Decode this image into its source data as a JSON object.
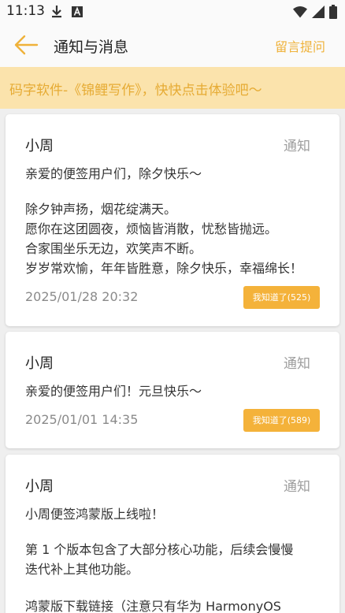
{
  "status_bar": {
    "time": "11:13",
    "icons": [
      "download-icon",
      "font-icon",
      "wifi-icon",
      "signal-icon",
      "battery-icon"
    ]
  },
  "header": {
    "title": "通知与消息",
    "feedback_label": "留言提问",
    "accent_color": "#efb23a"
  },
  "promo": {
    "text": "码字软件-《锦鲤写作》，快快点击体验吧～",
    "background": "#fbe3ac",
    "text_color": "#e6ab34"
  },
  "notifications": [
    {
      "sender": "小周",
      "type": "通知",
      "lines": [
        "亲爱的便签用户们，除夕快乐～",
        "除夕钟声扬，烟花绽满天。",
        "愿你在这团圆夜，烦恼皆消散，忧愁皆抛远。",
        "合家围坐乐无边，欢笑声不断。",
        "岁岁常欢愉，年年皆胜意，除夕快乐，幸福绵长！"
      ],
      "date": "2025/01/28 20:32",
      "ack_label": "我知道了(525)"
    },
    {
      "sender": "小周",
      "type": "通知",
      "lines": [
        "亲爱的便签用户们！元旦快乐～"
      ],
      "date": "2025/01/01 14:35",
      "ack_label": "我知道了(589)"
    },
    {
      "sender": "小周",
      "type": "通知",
      "lines": [
        "小周便签鸿蒙版上线啦！",
        "第 1 个版本包含了大部分核心功能，后续会慢慢",
        "迭代补上其他功能。",
        "鸿蒙版下载链接（注意只有华为 HarmonyOS"
      ]
    }
  ],
  "ack_button_color": "#f4b23a"
}
